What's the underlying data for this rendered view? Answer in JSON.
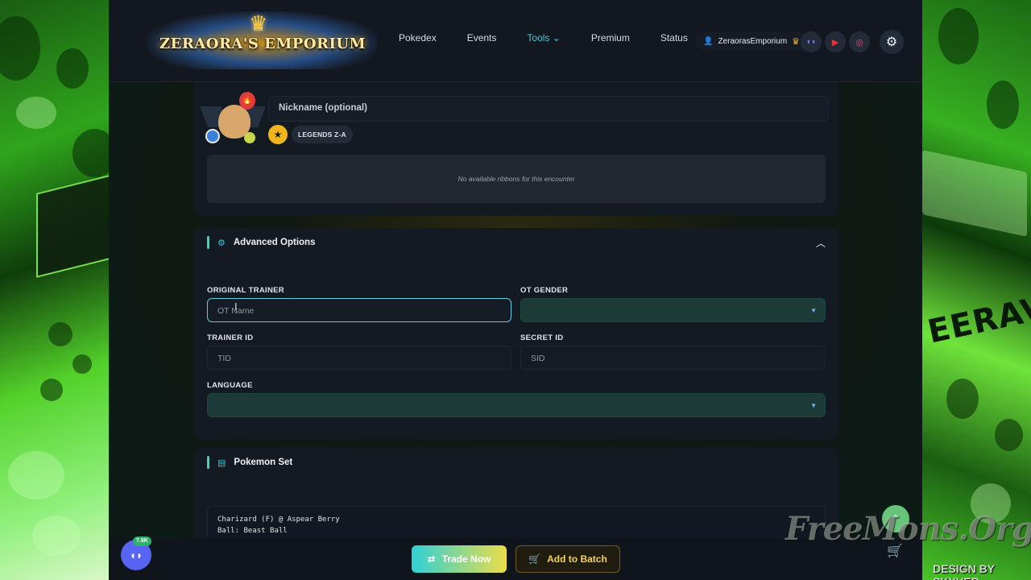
{
  "header": {
    "logo_text": "ZERAORA'S EMPORIUM",
    "nav": [
      "Pokedex",
      "Events",
      "Tools",
      "Premium",
      "Status"
    ],
    "tools_chevron": "⌄",
    "username": "ZeraorasEmporium",
    "social": {
      "discord": "◖◗",
      "youtube": "▶",
      "instagram": "◎"
    },
    "accent": "#3fc7d9"
  },
  "pokemon_card": {
    "nickname_placeholder": "Nickname (optional)",
    "star": "★",
    "game_badge": "LEGENDS Z-A",
    "ribbons_message": "No available ribbons for this encounter"
  },
  "advanced": {
    "title": "Advanced Options",
    "gear": "⚙",
    "chevron": "︿",
    "labels": {
      "original_trainer": "ORIGINAL TRAINER",
      "ot_gender": "OT GENDER",
      "trainer_id": "TRAINER ID",
      "secret_id": "SECRET ID",
      "language": "LANGUAGE"
    },
    "placeholders": {
      "ot_name": "OT Name",
      "tid": "TID",
      "sid": "SID"
    },
    "ot_gender_value": "",
    "language_value": ""
  },
  "pokemon_set": {
    "title": "Pokemon Set",
    "text": "Charizard (F) @ Aspear Berry\nBall: Beast Ball"
  },
  "actions": {
    "trade_label": "Trade Now",
    "batch_label": "Add to Batch",
    "discord_count": "7.9K"
  },
  "watermark": {
    "main": "FreeMons.Org",
    "credit": "DESIGN BY SKYVER"
  },
  "side_text": "EERAVIOM"
}
